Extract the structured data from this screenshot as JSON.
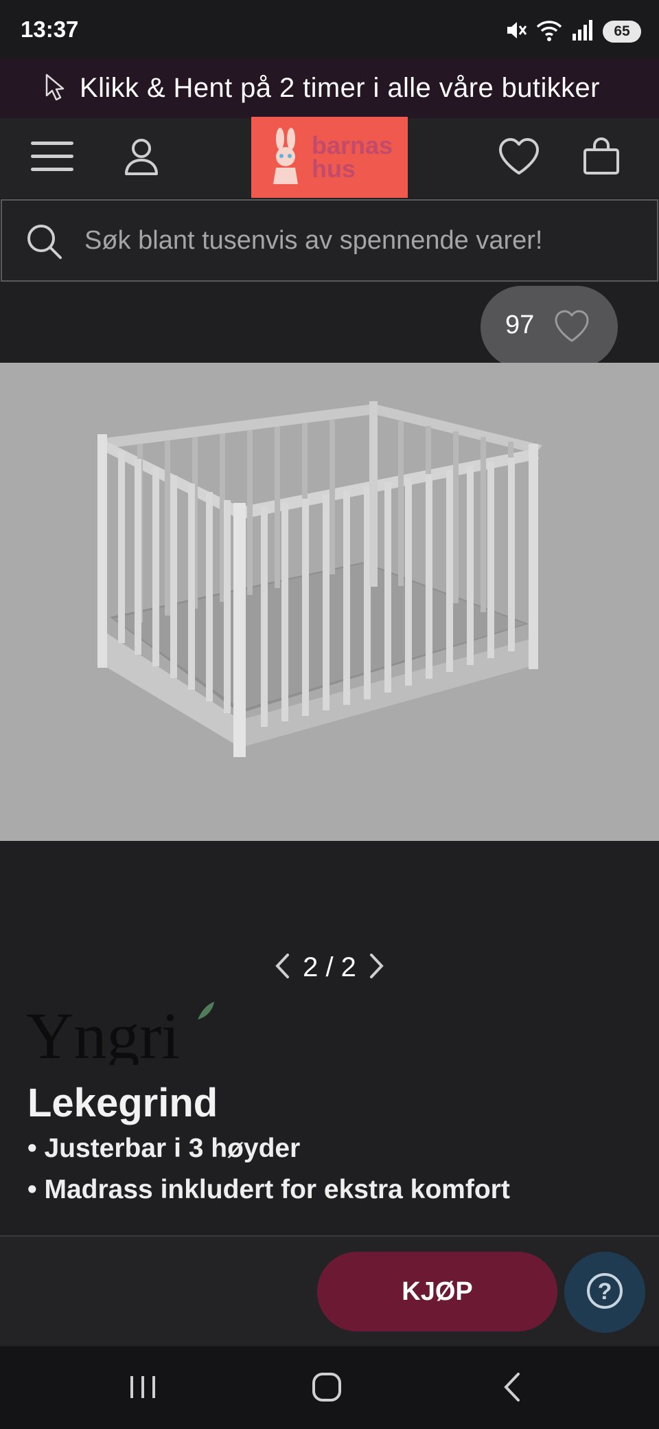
{
  "status_bar": {
    "time": "13:37",
    "battery": "65",
    "icons": [
      "mute-icon",
      "wifi-icon",
      "signal-icon",
      "battery-icon"
    ]
  },
  "promo": {
    "text": "Klikk & Hent på 2 timer i alle våre butikker",
    "icon": "cursor-icon"
  },
  "header": {
    "logo_line1": "barnas",
    "logo_line2": "hus",
    "icons": [
      "menu-icon",
      "account-icon",
      "heart-icon",
      "bag-icon"
    ]
  },
  "search": {
    "placeholder": "Søk blant tusenvis av spennende varer!"
  },
  "favorites": {
    "count": "97"
  },
  "gallery": {
    "current": "2 / 2"
  },
  "product": {
    "brand": "Yngri",
    "title": "Lekegrind",
    "bullets": [
      "• Justerbar i 3 høyder",
      "• Madrass inkludert for ekstra komfort"
    ]
  },
  "actions": {
    "buy_label": "KJØP",
    "help_label": "?"
  },
  "colors": {
    "background": "#1f1f21",
    "promo_bg": "#241622",
    "logo_bg": "#f05a4e",
    "buy_button": "#6c1a34",
    "help_button": "#1e3b52"
  }
}
